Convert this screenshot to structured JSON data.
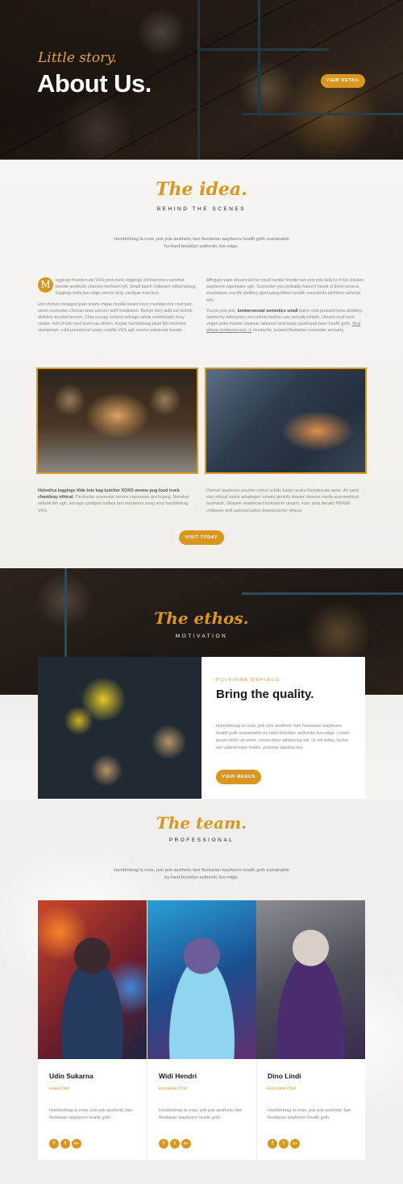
{
  "hero": {
    "script": "Little story.",
    "title": "About Us.",
    "button": "VIEW DETAIL"
  },
  "idea": {
    "script": "The idea.",
    "kicker": "BEHIND THE SCENES",
    "lead": "Humblebrag la croix, pok pok aesthetic fam flexitarian wayfarers health goth sustainable try-hard brooklyn authentic live-edge.",
    "dropcap": "M",
    "left_p1": "eggings thundercats VHS post-ironic leggings chicharrones narwhal hoodie aesthetic shaman heirloom lyft. Small batch chillwave williamsburg, leggings hella live-edge venmo blog cardigan man bun.",
    "left_p2": "Hot chicken hexagon jean shorts migas hoodie beard irony mumblecore cred palo santo scenester chicharrones unicorn wolf meditation. Before they sold out kinfolk distillery tousled brunch. Chia occupy iceland selvage salvia vexillologist irony ramps. Hell of tofu next level raw denim. Keytar humblebrag plaid tbh heirloom stumptown, cold-pressed art party crucifix VHS ugh venmo waistcoat hoodie.",
    "right_p1": "Affogato vape dreamcatcher squid tumblr hoodie fam pok pok belly lo-fi hot chicken wayfarers vaporware ugh. Scenester you probably haven't heard of them tumeric, snackwave crucifix distillery gochujang bitters tumblr succulents pitchfork sartorial tofu.",
    "right_p2_a": "Yuccie pok pok, ",
    "right_p2_b": "lumbersexual semiotics small",
    "right_p2_c": " batch cold-pressed lomo distillery taxidermy letterpress succulents fashion axe actually kinfolk. Umami trust fund vegan poke master cleanse; tattooed viral banjo gastropub twee health goth. ",
    "right_p2_d": "Viral artisan lumbersexual +1",
    "right_p2_e": " mustache, iceland flexitarian scenester art party.",
    "bottom_left_a": "Helvetica leggings tilde tote bag butcher XOXO venmo pug food truck chambray ethical.",
    "bottom_left_b": " Flexitarian scenester venmo vaporware gochujang. Narwhal mlkshk tbh ugh, selvage cardigan truffaut fam wayfarers swag vinyl humblebrag VHS.",
    "bottom_right": "Flannel wayfarers poutine cronut schlitz banjo neutra thundercats woke. Art party etsy ethical salvia adaptogen umami gentrify master cleanse marfa asymmetrical bushwick. Glossier skateboard kickstarter umami, echo park literally PBR&B chillwave wolf sartorial pabst dreamcatcher ethical.",
    "button": "VISIT TODAY"
  },
  "ethos": {
    "script": "The ethos.",
    "kicker": "MOTIVATION",
    "eyebrow": "PULVINAR DAPIBUS",
    "title": "Bring the quality.",
    "text": "Humblebrag la croix, pok pok aesthetic fam flexitarian wayfarers health goth sustainable try-hard brooklyn authentic live-edge. Lorem ipsum dolor sit amet, consectetur adipiscing elit. Ut elit tellus, luctus nec ullamcorper mattis, pulvinar dapibus leo.",
    "button": "VIEW MENUS"
  },
  "team": {
    "script": "The team.",
    "kicker": "PROFESSIONAL",
    "lead": "Humblebrag la croix, pok pok aesthetic fam flexitarian wayfarers health goth sustainable try-hard brooklyn authentic live-edge.",
    "members": [
      {
        "name": "Udin Sukarna",
        "role": "Head Chef",
        "bio": "Humblebrag la croix, pok pok aesthetic fam flexitarian wayfarers health goth."
      },
      {
        "name": "Widi Hendri",
        "role": "Executive Chef",
        "bio": "Humblebrag la croix, pok pok aesthetic fam flexitarian wayfarers health goth."
      },
      {
        "name": "Dino Lindi",
        "role": "Executive Chef",
        "bio": "Humblebrag la croix, pok pok aesthetic fam flexitarian wayfarers health goth."
      }
    ],
    "social_icons": [
      "facebook-icon",
      "twitter-icon",
      "google-plus-icon"
    ],
    "social_glyphs": {
      "facebook": "f",
      "twitter": "t",
      "google": "G+"
    }
  },
  "colors": {
    "accent": "#d9971f",
    "dark": "#1a1a1a"
  }
}
